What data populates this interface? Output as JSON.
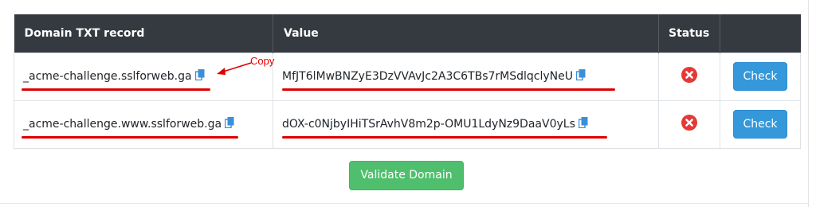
{
  "table": {
    "headers": {
      "domain": "Domain TXT record",
      "value": "Value",
      "status": "Status",
      "action": ""
    },
    "rows": [
      {
        "domain": "_acme-challenge.sslforweb.ga",
        "value": "MfJT6lMwBNZyE3DzVVAvJc2A3C6TBs7rMSdlqclyNeU",
        "status_icon": "error-x-icon",
        "button_label": "Check"
      },
      {
        "domain": "_acme-challenge.www.sslforweb.ga",
        "value": "dOX-c0NjbyIHiTSrAvhV8m2p-OMU1LdyNz9DaaV0yLs",
        "status_icon": "error-x-icon",
        "button_label": "Check"
      }
    ]
  },
  "annotation": {
    "label": "Copy",
    "color": "#e00000"
  },
  "validate_button": {
    "label": "Validate Domain",
    "color": "#4fbf6d"
  },
  "colors": {
    "header_bg": "#343a40",
    "check_button": "#3498db",
    "status_error": "#e53935",
    "copy_icon": "#3b8fd9"
  }
}
